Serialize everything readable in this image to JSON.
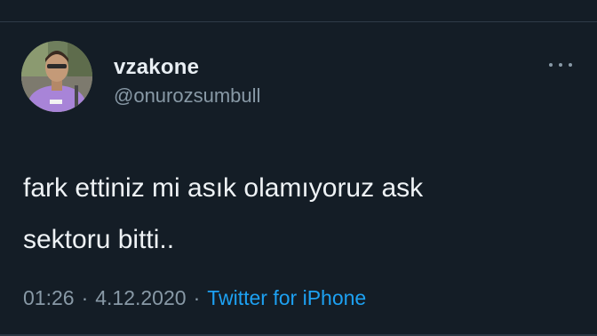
{
  "tweet": {
    "display_name": "vzakone",
    "handle": "@onurozsumbull",
    "text": "fark ettiniz mi asık olamıyoruz ask\nsektoru bitti..",
    "time": "01:26",
    "date": "4.12.2020",
    "source": "Twitter for iPhone",
    "separator": "·"
  },
  "icons": {
    "more": "more-options-icon",
    "avatar": "profile-avatar"
  },
  "colors": {
    "background": "#141d26",
    "link": "#1da1f2",
    "secondary_text": "#8899a6",
    "primary_text": "#eef2f5"
  }
}
